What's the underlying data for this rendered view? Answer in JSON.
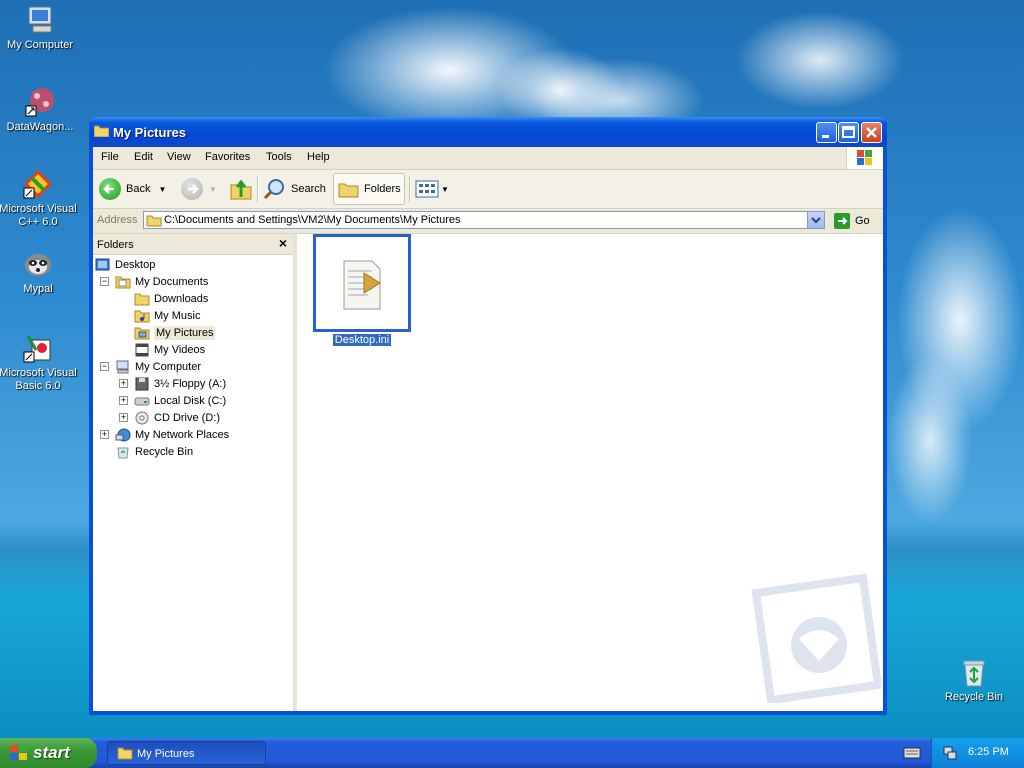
{
  "desktop": {
    "icons": [
      {
        "label": "My Computer"
      },
      {
        "label": "DataWagon..."
      },
      {
        "label": "Microsoft Visual C++ 6.0"
      },
      {
        "label": "Mypal"
      },
      {
        "label": "Microsoft Visual Basic 6.0"
      },
      {
        "label": "Recycle Bin"
      }
    ]
  },
  "window": {
    "title": "My Pictures",
    "menu": [
      "File",
      "Edit",
      "View",
      "Favorites",
      "Tools",
      "Help"
    ],
    "toolbar": {
      "back": "Back",
      "search": "Search",
      "folders": "Folders"
    },
    "address": {
      "label": "Address",
      "value": "C:\\Documents and Settings\\VM2\\My Documents\\My Pictures",
      "go": "Go"
    },
    "folders_panel": {
      "title": "Folders",
      "close": "×",
      "tree": [
        {
          "label": "Desktop"
        },
        {
          "label": "My Documents",
          "expander": "−"
        },
        {
          "label": "Downloads"
        },
        {
          "label": "My Music"
        },
        {
          "label": "My Pictures"
        },
        {
          "label": "My Videos"
        },
        {
          "label": "My Computer",
          "expander": "−"
        },
        {
          "label": "3½ Floppy (A:)",
          "expander": "+"
        },
        {
          "label": "Local Disk (C:)",
          "expander": "+"
        },
        {
          "label": "CD Drive (D:)",
          "expander": "+"
        },
        {
          "label": "My Network Places",
          "expander": "+"
        },
        {
          "label": "Recycle Bin"
        }
      ]
    },
    "files": [
      {
        "name": "Desktop.ini"
      }
    ]
  },
  "taskbar": {
    "start": "start",
    "task": "My Pictures",
    "clock": "6:25 PM"
  },
  "colors": {
    "selection": "#316ac5",
    "titlebar": "#0a5ae0"
  }
}
